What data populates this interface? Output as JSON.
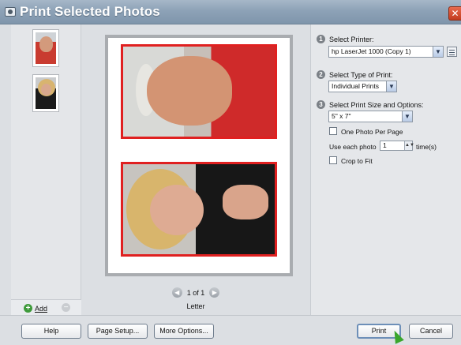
{
  "window": {
    "title": "Print Selected Photos",
    "close_glyph": "✕"
  },
  "sidebar": {
    "thumbnails": [
      {
        "name": "man-photo-thumbnail"
      },
      {
        "name": "woman-photo-thumbnail"
      }
    ],
    "add_label": "Add",
    "add_icon": "plus-icon",
    "remove_icon": "minus-icon"
  },
  "preview": {
    "page_count": "1 of 1",
    "paper_size": "Letter",
    "prev_glyph": "◀",
    "next_glyph": "▶"
  },
  "options": {
    "step1": {
      "badge": "1",
      "label": "Select Printer:",
      "value": "hp LaserJet 1000 (Copy 1)"
    },
    "step2": {
      "badge": "2",
      "label": "Select Type of Print:",
      "value": "Individual Prints"
    },
    "step3": {
      "badge": "3",
      "label": "Select Print Size and Options:",
      "value": "5\" x 7\""
    },
    "one_per_page": "One Photo Per Page",
    "use_each_label": "Use each photo",
    "use_each_value": "1",
    "times_label": "time(s)",
    "crop_to_fit": "Crop to Fit"
  },
  "buttons": {
    "help": "Help",
    "page_setup": "Page Setup...",
    "more_options": "More Options...",
    "print": "Print",
    "cancel": "Cancel"
  },
  "colors": {
    "accent_red": "#e02020",
    "titlebar": "#8da2b7"
  }
}
